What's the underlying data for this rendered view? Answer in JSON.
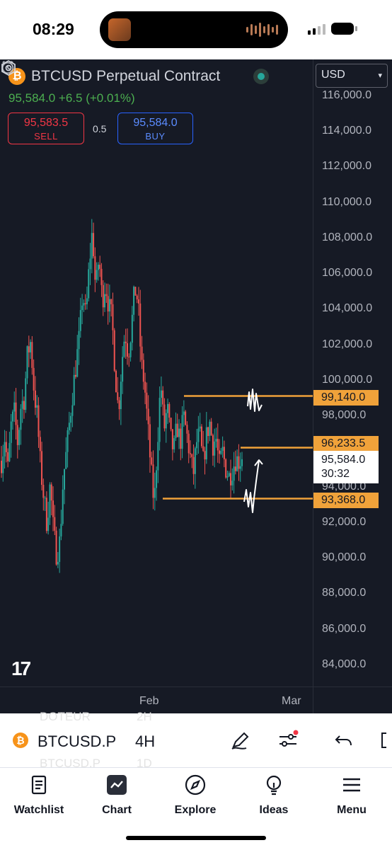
{
  "status_bar": {
    "time": "08:29"
  },
  "header": {
    "title": "BTCUSD Perpetual Contract",
    "currency": "USD",
    "last_price": "95,584.0",
    "change": "+6.5",
    "change_pct": "(+0.01%)"
  },
  "trade": {
    "sell_price": "95,583.5",
    "sell_label": "SELL",
    "spread": "0.5",
    "buy_price": "95,584.0",
    "buy_label": "BUY"
  },
  "price_axis": {
    "labels": [
      "116,000.0",
      "114,000.0",
      "112,000.0",
      "110,000.0",
      "108,000.0",
      "106,000.0",
      "104,000.0",
      "102,000.0",
      "100,000.0",
      "98,000.0",
      "94,000.0",
      "92,000.0",
      "90,000.0",
      "88,000.0",
      "86,000.0",
      "84,000.0"
    ],
    "levels": [
      {
        "value": "99,140.0",
        "price": 99140
      },
      {
        "value": "96,233.5",
        "price": 96233.5
      },
      {
        "value": "93,368.0",
        "price": 93368
      }
    ],
    "current_price": "95,584.0",
    "countdown": "30:32"
  },
  "time_axis": {
    "labels": [
      "Feb",
      "Mar"
    ]
  },
  "colors": {
    "up": "#26a69a",
    "down": "#ef5350",
    "level": "#f0a23a",
    "background": "#161a25",
    "accent_btc": "#f7931a"
  },
  "toolbar": {
    "symbol": "BTCUSD.P",
    "interval": "4H",
    "ghost_above_symbol": "DOTEUR",
    "ghost_above_interval": "2H",
    "ghost_below_symbol": "BTCUSD.P",
    "ghost_below_interval": "1D",
    "icons": [
      "draw-pen-icon",
      "indicators-icon",
      "undo-icon",
      "layout-icon"
    ]
  },
  "nav": {
    "items": [
      {
        "label": "Watchlist",
        "icon": "watchlist-icon"
      },
      {
        "label": "Chart",
        "icon": "chart-icon",
        "active": true
      },
      {
        "label": "Explore",
        "icon": "compass-icon"
      },
      {
        "label": "Ideas",
        "icon": "lightbulb-icon"
      },
      {
        "label": "Menu",
        "icon": "hamburger-icon"
      }
    ]
  },
  "chart_data": {
    "type": "candlestick",
    "symbol": "BTCUSD Perpetual Contract",
    "interval": "4H",
    "ylim": [
      83000,
      117000
    ],
    "x_labels": [
      "Feb",
      "Mar"
    ],
    "price_path": [
      95500,
      96800,
      95000,
      97500,
      98200,
      96500,
      98600,
      99000,
      101500,
      102200,
      99500,
      98000,
      95200,
      93500,
      92000,
      94200,
      91500,
      90200,
      91000,
      94500,
      96000,
      97800,
      99500,
      101000,
      102500,
      105000,
      103500,
      106500,
      108500,
      105000,
      107000,
      104500,
      105500,
      104200,
      103500,
      100500,
      98200,
      101000,
      102800,
      101500,
      103000,
      105200,
      104500,
      101000,
      99800,
      97500,
      95000,
      93000,
      96500,
      100000,
      97200,
      98500,
      96800,
      96000,
      97500,
      96500,
      98000,
      97000,
      95800,
      94700,
      96500,
      97000,
      95300,
      96800,
      97700,
      96400,
      96800,
      95200,
      96000,
      95100,
      94600,
      95000,
      95600,
      95500,
      95584
    ],
    "levels": [
      99140,
      96233.5,
      93368
    ],
    "last": 95584.0
  }
}
